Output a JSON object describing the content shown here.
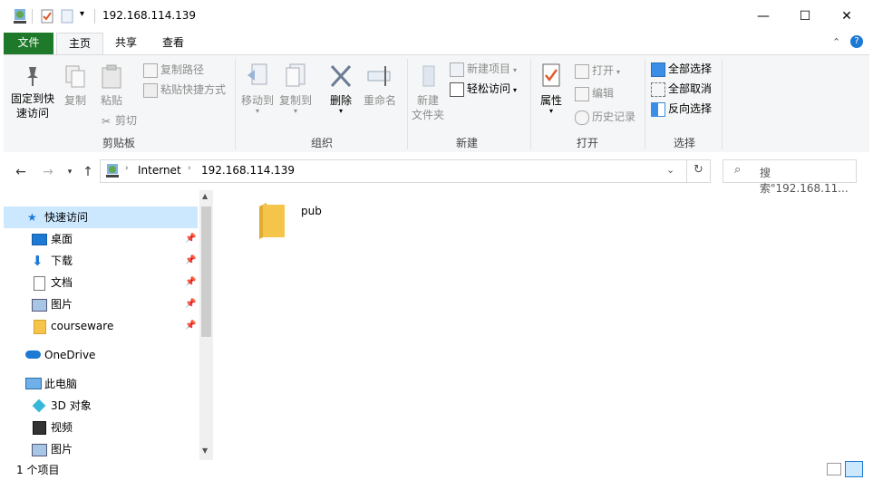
{
  "window": {
    "title": "192.168.114.139",
    "minimize_glyph": "—",
    "maximize_glyph": "☐",
    "close_glyph": "✕"
  },
  "tabs": [
    {
      "label": "文件"
    },
    {
      "label": "主页"
    },
    {
      "label": "共享"
    },
    {
      "label": "查看"
    }
  ],
  "ribbon": {
    "clipboard": {
      "group_label": "剪贴板",
      "pin_label_line1": "固定到快",
      "pin_label_line2": "速访问",
      "copy_label": "复制",
      "paste_label": "粘贴",
      "copy_path_label": "复制路径",
      "paste_shortcut_label": "粘贴快捷方式",
      "cut_label": "剪切"
    },
    "organize": {
      "group_label": "组织",
      "move_to_label": "移动到",
      "copy_to_label": "复制到",
      "delete_label": "删除",
      "rename_label": "重命名"
    },
    "new": {
      "group_label": "新建",
      "new_folder_line1": "新建",
      "new_folder_line2": "文件夹",
      "new_item_label": "新建项目",
      "easy_access_label": "轻松访问"
    },
    "open": {
      "group_label": "打开",
      "properties_label": "属性",
      "open_label": "打开",
      "edit_label": "编辑",
      "history_label": "历史记录"
    },
    "select": {
      "group_label": "选择",
      "select_all_label": "全部选择",
      "select_none_label": "全部取消",
      "invert_label": "反向选择"
    }
  },
  "address": {
    "segments": [
      "Internet",
      "192.168.114.139"
    ],
    "search_placeholder": "搜索\"192.168.11..."
  },
  "nav": {
    "quick_access": "快速访问",
    "items": [
      {
        "label": "桌面"
      },
      {
        "label": "下载"
      },
      {
        "label": "文档"
      },
      {
        "label": "图片"
      },
      {
        "label": "courseware"
      }
    ],
    "onedrive": "OneDrive",
    "this_pc": "此电脑",
    "pc_items": [
      {
        "label": "3D 对象"
      },
      {
        "label": "视频"
      },
      {
        "label": "图片"
      }
    ]
  },
  "content": {
    "items": [
      {
        "name": "pub"
      }
    ]
  },
  "status": {
    "item_count": "1 个项目"
  },
  "colors": {
    "file_tab": "#1e7a2a",
    "folder": "#f4c54a",
    "selection": "#cce8ff",
    "ribbon_bg": "#f5f6f7"
  }
}
